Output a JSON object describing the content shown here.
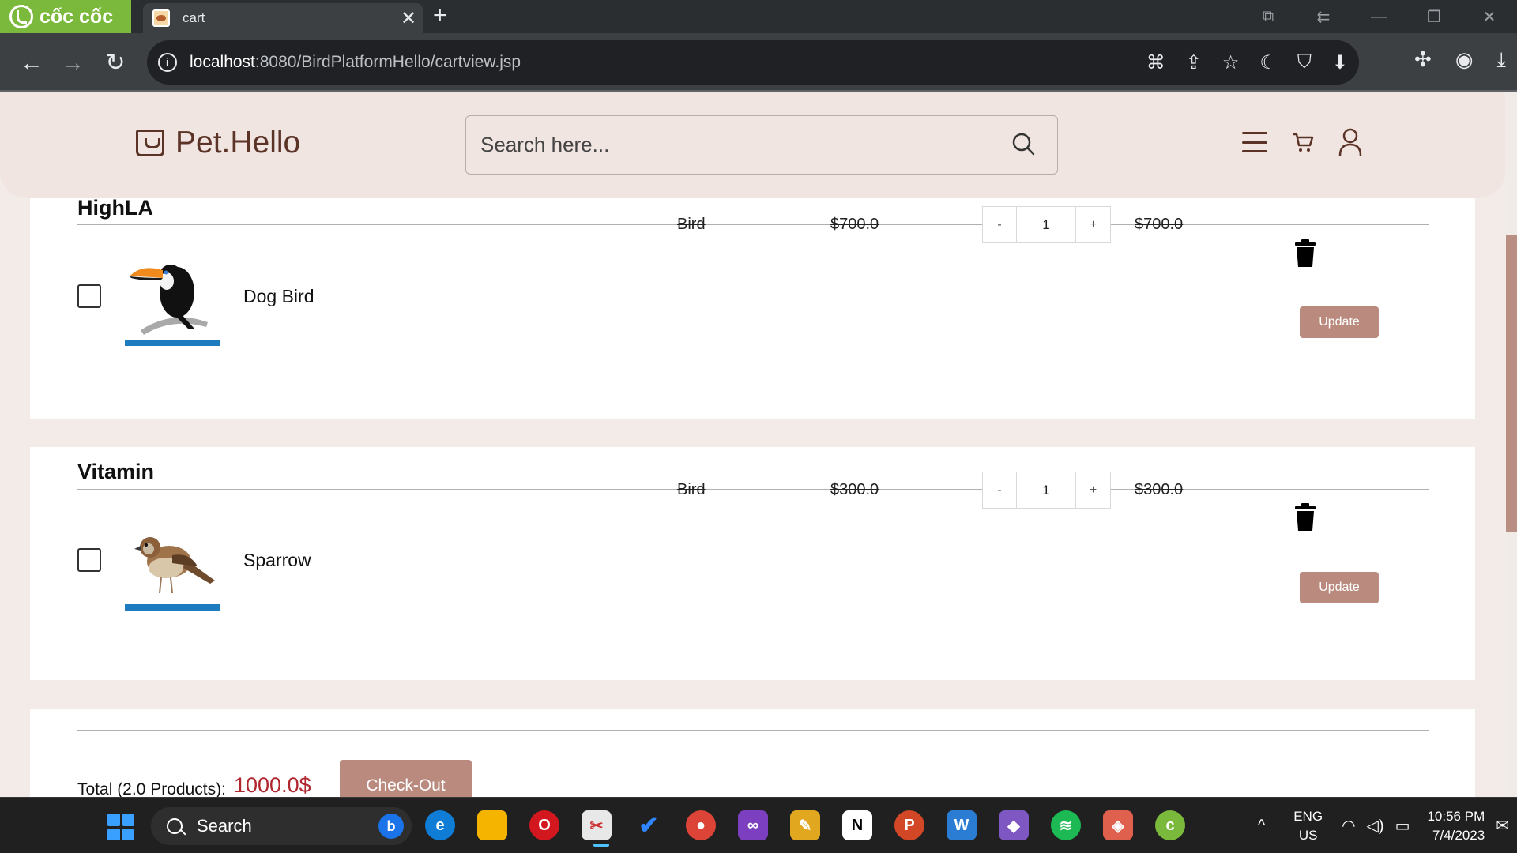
{
  "browser": {
    "brand": "cốc cốc",
    "tab_title": "cart",
    "url_host": "localhost",
    "url_rest": ":8080/BirdPlatformHello/cartview.jsp"
  },
  "site": {
    "logo_text": "Pet.Hello",
    "search_placeholder": "Search here..."
  },
  "cart": {
    "groups": [
      {
        "shop": "HighLA",
        "item": {
          "category": "Bird",
          "unit_price": "$700.0",
          "qty_minus": "-",
          "quantity": "1",
          "qty_plus": "+",
          "line_total": "$700.0",
          "name": "Dog Bird",
          "image": "toucan-image",
          "update_label": "Update",
          "checked": false
        }
      },
      {
        "shop": "Vitamin",
        "item": {
          "category": "Bird",
          "unit_price": "$300.0",
          "qty_minus": "-",
          "quantity": "1",
          "qty_plus": "+",
          "line_total": "$300.0",
          "name": "Sparrow",
          "image": "sparrow-image",
          "update_label": "Update",
          "checked": false
        }
      }
    ],
    "total_label": "Total (2.0 Products):",
    "total_value": "1000.0$",
    "checkout_label": "Check-Out"
  },
  "taskbar": {
    "search_label": "Search",
    "lang_line1": "ENG",
    "lang_line2": "US",
    "time": "10:56 PM",
    "date": "7/4/2023"
  },
  "colors": {
    "accent": "#b98a7d",
    "total_red": "#b0262f",
    "header_bg": "#f0e5e1",
    "brand_green": "#7bb93c"
  }
}
